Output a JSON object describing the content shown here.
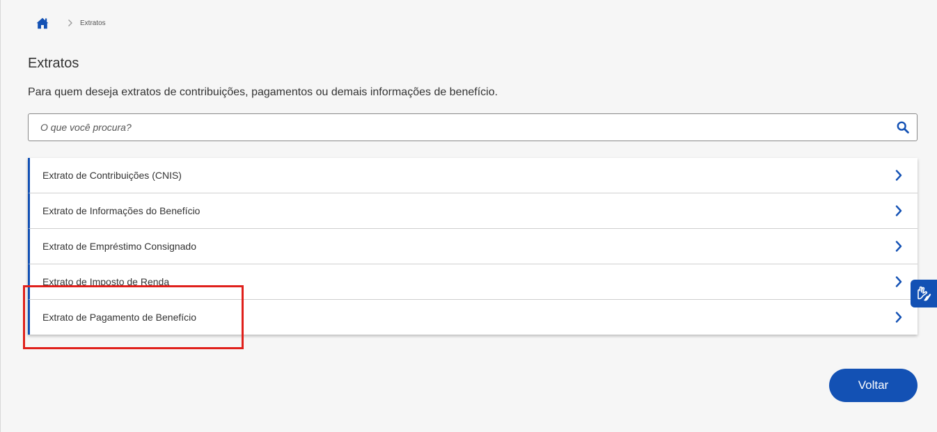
{
  "breadcrumb": {
    "home_icon": "home-icon",
    "separator_icon": "chevron-right-icon",
    "current": "Extratos"
  },
  "page": {
    "title": "Extratos",
    "description": "Para quem deseja extratos de contribuições, pagamentos ou demais informações de benefício."
  },
  "search": {
    "placeholder": "O que você procura?",
    "value": "",
    "icon": "search-icon"
  },
  "items": [
    {
      "label": "Extrato de Contribuições (CNIS)",
      "icon": "chevron-right-icon"
    },
    {
      "label": "Extrato de Informações do Benefício",
      "icon": "chevron-right-icon"
    },
    {
      "label": "Extrato de Empréstimo Consignado",
      "icon": "chevron-right-icon"
    },
    {
      "label": "Extrato de Imposto de Renda",
      "icon": "chevron-right-icon"
    },
    {
      "label": "Extrato de Pagamento de Benefício",
      "icon": "chevron-right-icon"
    }
  ],
  "highlight": {
    "target": "Extrato de Pagamento de Benefício",
    "color": "#e0201b"
  },
  "accessibility": {
    "icon": "sign-language-hands-icon"
  },
  "buttons": {
    "back_label": "Voltar"
  },
  "colors": {
    "primary": "#1351b4",
    "background": "#f6f6f6",
    "text": "#333333",
    "highlight": "#e0201b"
  }
}
